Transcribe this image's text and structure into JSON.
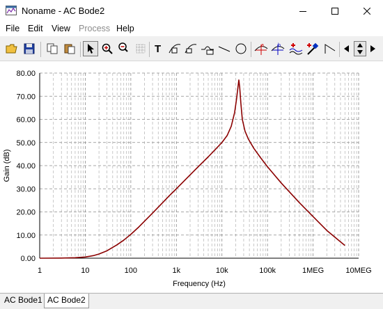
{
  "window": {
    "title": "Noname - AC Bode2",
    "minimize_icon": "minimize-icon",
    "maximize_icon": "maximize-icon",
    "close_icon": "close-icon"
  },
  "menu": {
    "items": [
      {
        "label": "File",
        "underline": "F"
      },
      {
        "label": "Edit",
        "underline": "E"
      },
      {
        "label": "View",
        "underline": "V"
      },
      {
        "label": "Process",
        "underline": "P",
        "disabled": true
      },
      {
        "label": "Help",
        "underline": "H"
      }
    ]
  },
  "toolbar": {
    "buttons": [
      "open-folder-icon",
      "save-icon",
      "copy-icon",
      "paste-icon",
      "pointer-icon",
      "zoom-in-icon",
      "zoom-100-icon",
      "grid-icon",
      "text-icon",
      "curve-label-icon",
      "curve-label-2-icon",
      "curve-label-3-icon",
      "line-icon",
      "circle-icon",
      "cursor-a-icon",
      "cursor-b-icon",
      "add-curve-icon",
      "marker-icon",
      "step-icon",
      "scroll-left-icon",
      "scroll-updown-icon",
      "scroll-right-icon"
    ]
  },
  "chart_data": {
    "type": "line",
    "xlabel": "Frequency (Hz)",
    "ylabel": "Gain (dB)",
    "x_scale": "log",
    "xlim": [
      1,
      10000000
    ],
    "ylim": [
      0,
      80
    ],
    "x_tick_labels": [
      "1",
      "10",
      "100",
      "1k",
      "10k",
      "100k",
      "1MEG",
      "10MEG"
    ],
    "x_tick_values": [
      1,
      10,
      100,
      1000,
      10000,
      100000,
      1000000,
      10000000
    ],
    "y_tick_labels": [
      "0.00",
      "10.00",
      "20.00",
      "30.00",
      "40.00",
      "50.00",
      "60.00",
      "70.00",
      "80.00"
    ],
    "y_tick_values": [
      0,
      10,
      20,
      30,
      40,
      50,
      60,
      70,
      80
    ],
    "grid": true,
    "series": [
      {
        "color": "#8b0000",
        "points": [
          [
            1,
            0
          ],
          [
            3,
            0.05
          ],
          [
            6,
            0.2
          ],
          [
            10,
            0.5
          ],
          [
            15,
            1.1
          ],
          [
            20,
            1.8
          ],
          [
            30,
            3.2
          ],
          [
            50,
            5.8
          ],
          [
            70,
            7.8
          ],
          [
            100,
            10.3
          ],
          [
            150,
            13.5
          ],
          [
            200,
            16
          ],
          [
            300,
            19.5
          ],
          [
            500,
            24
          ],
          [
            700,
            27
          ],
          [
            1000,
            30
          ],
          [
            2000,
            36
          ],
          [
            3000,
            39.5
          ],
          [
            5000,
            43.8
          ],
          [
            7000,
            46.8
          ],
          [
            10000,
            50
          ],
          [
            13000,
            53
          ],
          [
            16000,
            57
          ],
          [
            19000,
            63
          ],
          [
            21000,
            69
          ],
          [
            22500,
            74
          ],
          [
            23500,
            77
          ],
          [
            24500,
            74
          ],
          [
            26000,
            67
          ],
          [
            28000,
            60
          ],
          [
            32000,
            55
          ],
          [
            38000,
            51.5
          ],
          [
            50000,
            47.5
          ],
          [
            70000,
            43.5
          ],
          [
            100000,
            39.5
          ],
          [
            200000,
            32.5
          ],
          [
            500000,
            24
          ],
          [
            1000000,
            18
          ],
          [
            2000000,
            12
          ],
          [
            5000000,
            5.5
          ]
        ]
      }
    ]
  },
  "tabs": [
    {
      "label": "AC Bode1",
      "active": false
    },
    {
      "label": "AC Bode2",
      "active": true
    }
  ]
}
